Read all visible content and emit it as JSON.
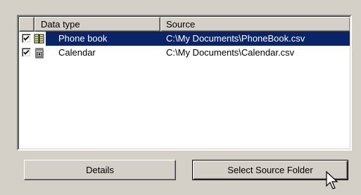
{
  "list": {
    "columns": [
      "",
      "Data type",
      "Source"
    ],
    "rows": [
      {
        "checked": true,
        "icon": "phone-book-icon",
        "data_type": "Phone book",
        "source": "C:\\My Documents\\PhoneBook.csv",
        "selected": true
      },
      {
        "checked": true,
        "icon": "calendar-icon",
        "data_type": "Calendar",
        "source": "C:\\My Documents\\Calendar.csv",
        "selected": false
      }
    ]
  },
  "buttons": {
    "details": "Details",
    "select_source_folder": "Select Source Folder"
  },
  "colors": {
    "selection": "#0a246a",
    "face": "#d4d0c8"
  }
}
